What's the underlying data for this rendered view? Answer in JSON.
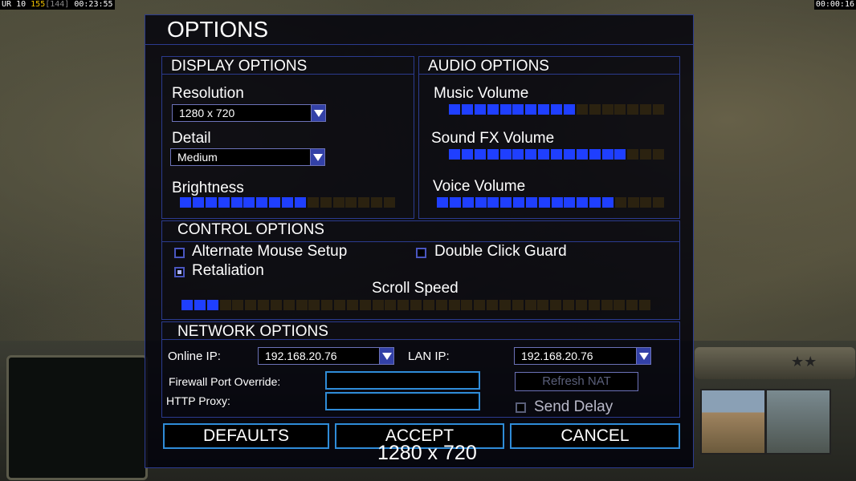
{
  "hud": {
    "left_prefix": "UR",
    "left_a": "10",
    "left_b": "155",
    "left_c": "[144]",
    "left_time": "00:23:55",
    "right_time": "00:00:16"
  },
  "dialog": {
    "title": "OPTIONS",
    "display": {
      "heading": "DISPLAY OPTIONS",
      "resolution_label": "Resolution",
      "resolution_value": "1280 x 720",
      "detail_label": "Detail",
      "detail_value": "Medium",
      "brightness_label": "Brightness",
      "brightness_level": 0.6
    },
    "audio": {
      "heading": "AUDIO OPTIONS",
      "music_label": "Music Volume",
      "music_level": 0.6,
      "sfx_label": "Sound FX Volume",
      "sfx_level": 0.8,
      "voice_label": "Voice Volume",
      "voice_level": 0.75
    },
    "control": {
      "heading": "CONTROL OPTIONS",
      "alt_mouse_label": "Alternate Mouse Setup",
      "alt_mouse_checked": false,
      "double_click_label": "Double Click Guard",
      "double_click_checked": false,
      "retaliation_label": "Retaliation",
      "retaliation_checked": true,
      "scroll_label": "Scroll Speed",
      "scroll_level": 0.08
    },
    "network": {
      "heading": "NETWORK OPTIONS",
      "online_ip_label": "Online IP:",
      "online_ip_value": "192.168.20.76",
      "lan_ip_label": "LAN IP:",
      "lan_ip_value": "192.168.20.76",
      "firewall_label": "Firewall Port Override:",
      "firewall_value": "",
      "http_proxy_label": "HTTP Proxy:",
      "http_proxy_value": "",
      "refresh_nat_label": "Refresh NAT",
      "send_delay_label": "Send Delay",
      "send_delay_checked": false
    },
    "buttons": {
      "defaults": "DEFAULTS",
      "accept": "ACCEPT",
      "cancel": "CANCEL"
    }
  },
  "overlay_resolution_text": "1280 x 720",
  "colors": {
    "slider_on": "#1f3fff",
    "slider_off": "#2b2210",
    "border": "#2b3b8f",
    "button_border": "#2f8cd8"
  }
}
